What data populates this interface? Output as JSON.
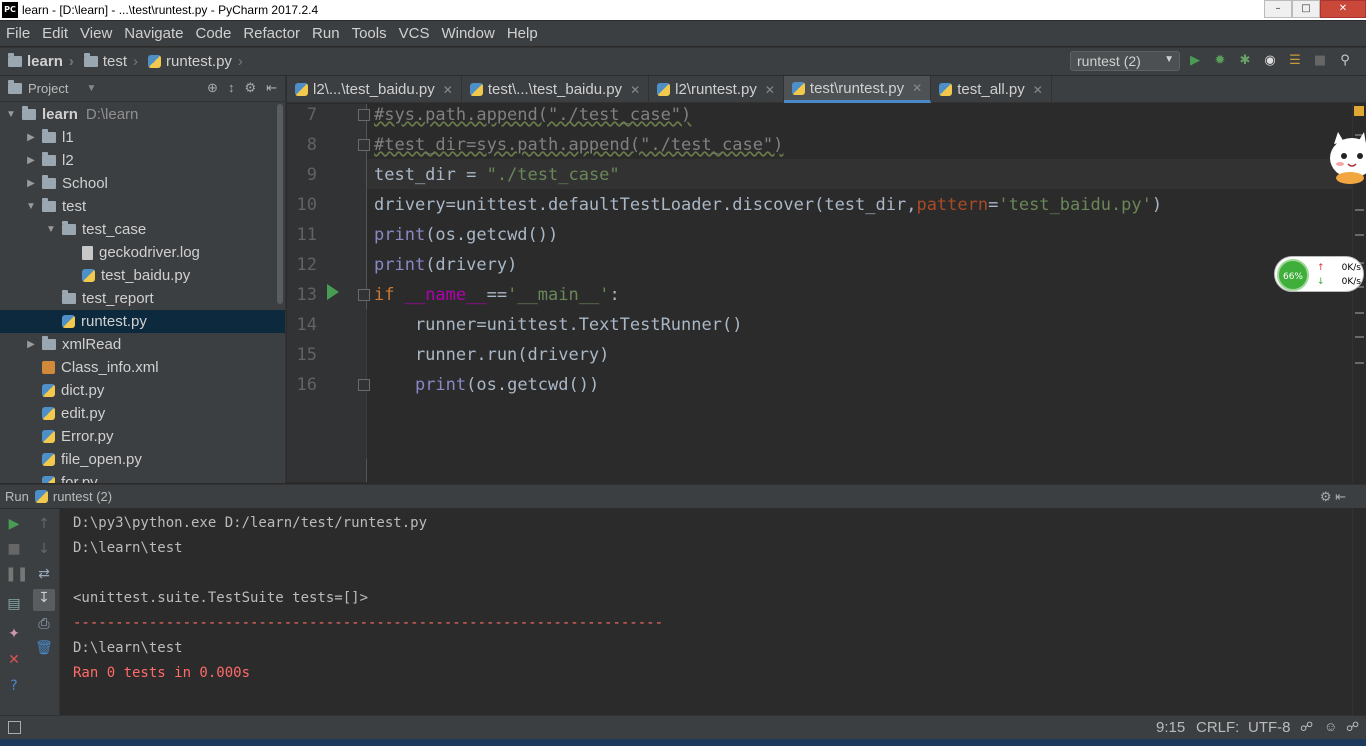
{
  "window": {
    "title": "learn - [D:\\learn] - ...\\test\\runtest.py - PyCharm 2017.2.4",
    "app_icon": "PC"
  },
  "menu": [
    "File",
    "Edit",
    "View",
    "Navigate",
    "Code",
    "Refactor",
    "Run",
    "Tools",
    "VCS",
    "Window",
    "Help"
  ],
  "breadcrumb": [
    "learn",
    "test",
    "runtest.py"
  ],
  "run_config": "runtest (2)",
  "project_panel": {
    "title": "Project",
    "tree": [
      {
        "label": "learn",
        "extra": "D:\\learn",
        "level": 0,
        "arrow": "open",
        "icon": "folder"
      },
      {
        "label": "l1",
        "level": 1,
        "arrow": "closed",
        "icon": "folder"
      },
      {
        "label": "l2",
        "level": 1,
        "arrow": "closed",
        "icon": "folder"
      },
      {
        "label": "School",
        "level": 1,
        "arrow": "closed",
        "icon": "folder"
      },
      {
        "label": "test",
        "level": 1,
        "arrow": "open",
        "icon": "folder"
      },
      {
        "label": "test_case",
        "level": 2,
        "arrow": "open",
        "icon": "folder"
      },
      {
        "label": "geckodriver.log",
        "level": 3,
        "arrow": "none",
        "icon": "file"
      },
      {
        "label": "test_baidu.py",
        "level": 3,
        "arrow": "none",
        "icon": "python"
      },
      {
        "label": "test_report",
        "level": 2,
        "arrow": "none",
        "icon": "folder"
      },
      {
        "label": "runtest.py",
        "level": 2,
        "arrow": "none",
        "icon": "python",
        "selected": true
      },
      {
        "label": "xmlRead",
        "level": 1,
        "arrow": "closed",
        "icon": "folder"
      },
      {
        "label": "Class_info.xml",
        "level": 1,
        "arrow": "none",
        "icon": "xml"
      },
      {
        "label": "dict.py",
        "level": 1,
        "arrow": "none",
        "icon": "python"
      },
      {
        "label": "edit.py",
        "level": 1,
        "arrow": "none",
        "icon": "python"
      },
      {
        "label": "Error.py",
        "level": 1,
        "arrow": "none",
        "icon": "python"
      },
      {
        "label": "file_open.py",
        "level": 1,
        "arrow": "none",
        "icon": "python"
      },
      {
        "label": "for.py",
        "level": 1,
        "arrow": "none",
        "icon": "python"
      }
    ]
  },
  "tabs": [
    {
      "label": "l2\\...\\test_baidu.py",
      "active": false
    },
    {
      "label": "test\\...\\test_baidu.py",
      "active": false
    },
    {
      "label": "l2\\runtest.py",
      "active": false
    },
    {
      "label": "test\\runtest.py",
      "active": true
    },
    {
      "label": "test_all.py",
      "active": false
    }
  ],
  "editor": {
    "line_numbers": [
      "7",
      "8",
      "9",
      "10",
      "11",
      "12",
      "13",
      "14",
      "15",
      "16"
    ],
    "lines": [
      [
        {
          "t": "#sys.path.append(\"./test_case\")",
          "c": "com"
        }
      ],
      [
        {
          "t": "#test_dir=sys.path.append(\"./test_case\")",
          "c": "com"
        }
      ],
      [
        {
          "t": "test_dir = ",
          "c": "txt"
        },
        {
          "t": "\"./test_case\"",
          "c": "str"
        }
      ],
      [
        {
          "t": "drivery=unittest.defaultTestLoader.discover(test_dir,",
          "c": "txt"
        },
        {
          "t": "pattern",
          "c": "param"
        },
        {
          "t": "=",
          "c": "txt"
        },
        {
          "t": "'test_baidu.py'",
          "c": "str"
        },
        {
          "t": ")",
          "c": "txt"
        }
      ],
      [
        {
          "t": "print",
          "c": "fn"
        },
        {
          "t": "(os.getcwd())",
          "c": "txt"
        }
      ],
      [
        {
          "t": "print",
          "c": "fn"
        },
        {
          "t": "(drivery)",
          "c": "txt"
        }
      ],
      [
        {
          "t": "if ",
          "c": "kw"
        },
        {
          "t": "__name__",
          "c": "dund"
        },
        {
          "t": "==",
          "c": "txt"
        },
        {
          "t": "'__main__'",
          "c": "str"
        },
        {
          "t": ":",
          "c": "txt"
        }
      ],
      [
        {
          "t": "    runner=unittest.TextTestRunner()",
          "c": "txt"
        }
      ],
      [
        {
          "t": "    runner.run(drivery)",
          "c": "txt"
        }
      ],
      [
        {
          "t": "    ",
          "c": "txt"
        },
        {
          "t": "print",
          "c": "fn"
        },
        {
          "t": "(os.getcwd())",
          "c": "txt"
        }
      ]
    ]
  },
  "speed_widget": {
    "percent": "66%",
    "up": "0K/s",
    "down": "0K/s"
  },
  "run_panel": {
    "label": "Run",
    "config": "runtest (2)",
    "output": [
      {
        "text": "D:\\py3\\python.exe D:/learn/test/runtest.py",
        "red": false
      },
      {
        "text": "D:\\learn\\test",
        "red": false
      },
      {
        "text": "",
        "red": false
      },
      {
        "text": "<unittest.suite.TestSuite tests=[]>",
        "red": false
      },
      {
        "text": "----------------------------------------------------------------------",
        "red": true
      },
      {
        "text": "D:\\learn\\test",
        "red": false
      },
      {
        "text": "Ran 0 tests in 0.000s",
        "red": true
      }
    ]
  },
  "status": {
    "position": "9:15",
    "line_sep": "CRLF:",
    "encoding": "UTF-8"
  },
  "colors": {
    "accent": "#4a88c7",
    "run_green": "#499c54",
    "error_red": "#ff6b68"
  }
}
